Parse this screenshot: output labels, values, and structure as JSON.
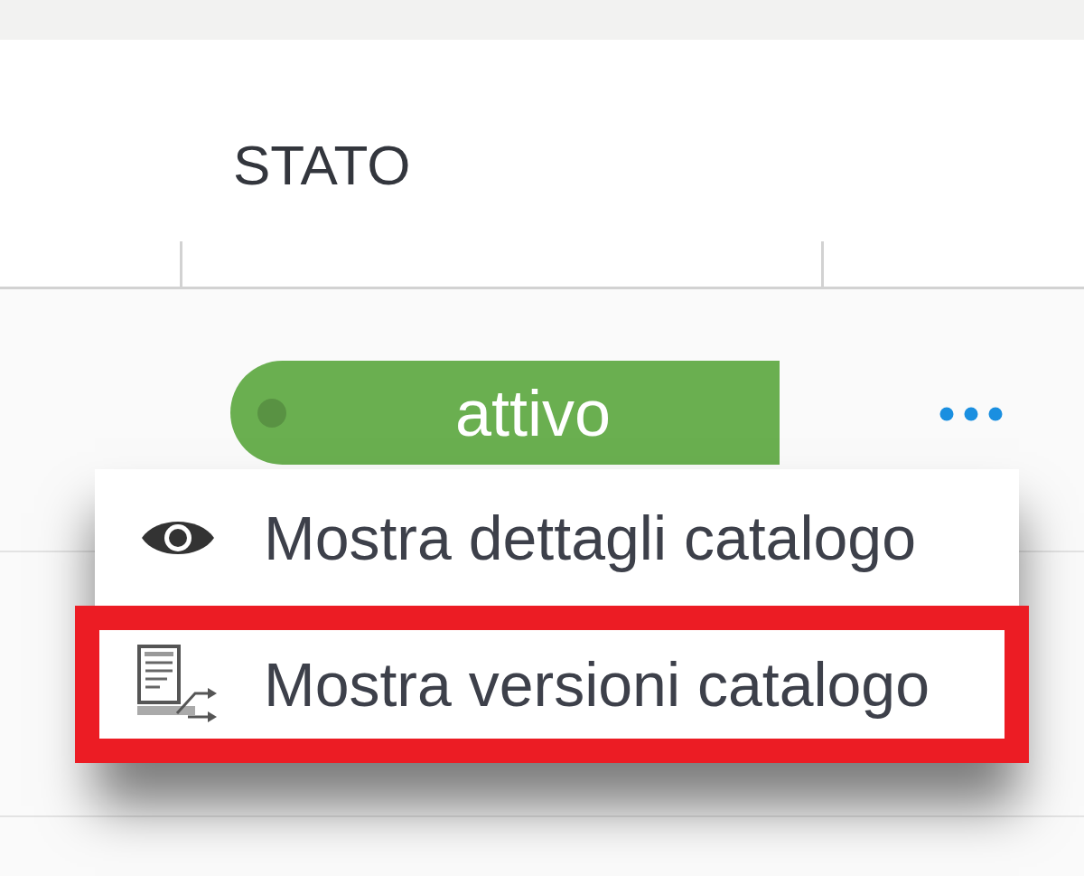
{
  "table": {
    "columns": {
      "status": "STATO"
    },
    "rows": [
      {
        "status": {
          "label": "attivo",
          "color": "#6aaf50"
        },
        "actions_menu": {
          "items": [
            {
              "kind": "details",
              "label": "Mostra dettagli catalogo",
              "highlighted": false
            },
            {
              "kind": "versions",
              "label": "Mostra versioni catalogo",
              "highlighted": true
            }
          ]
        }
      }
    ]
  }
}
